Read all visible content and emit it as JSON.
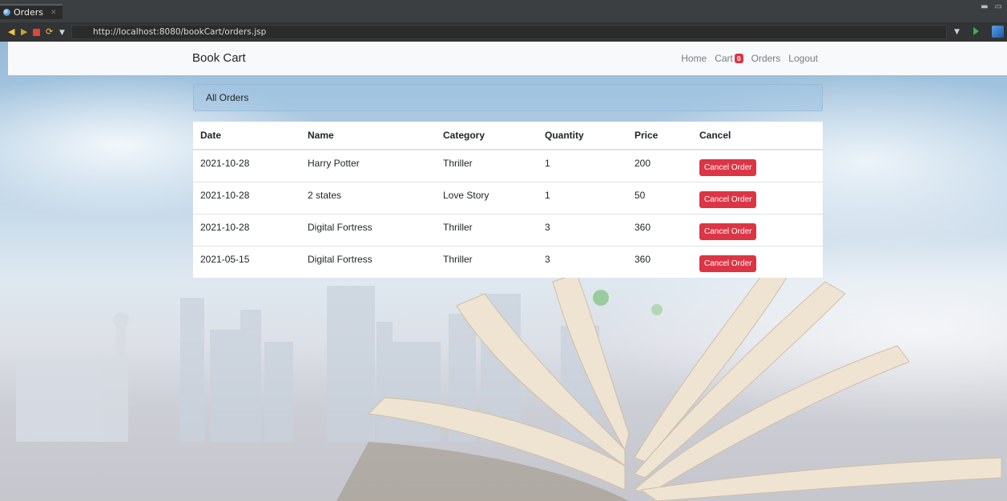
{
  "browser": {
    "tab_title": "Orders",
    "url": "http://localhost:8080/bookCart/orders.jsp"
  },
  "navbar": {
    "brand": "Book Cart",
    "links": {
      "home": "Home",
      "cart": "Cart",
      "cart_count": "0",
      "orders": "Orders",
      "logout": "Logout"
    }
  },
  "card": {
    "header": "All Orders"
  },
  "table": {
    "columns": [
      "Date",
      "Name",
      "Category",
      "Quantity",
      "Price",
      "Cancel"
    ],
    "rows": [
      {
        "date": "2021-10-28",
        "name": "Harry Potter",
        "category": "Thriller",
        "quantity": "1",
        "price": "200",
        "action": "Cancel Order"
      },
      {
        "date": "2021-10-28",
        "name": "2 states",
        "category": "Love Story",
        "quantity": "1",
        "price": "50",
        "action": "Cancel Order"
      },
      {
        "date": "2021-10-28",
        "name": "Digital Fortress",
        "category": "Thriller",
        "quantity": "3",
        "price": "360",
        "action": "Cancel Order"
      },
      {
        "date": "2021-05-15",
        "name": "Digital Fortress",
        "category": "Thriller",
        "quantity": "3",
        "price": "360",
        "action": "Cancel Order"
      }
    ]
  },
  "colors": {
    "danger": "#dc3545",
    "navbar_bg": "#f8f9fa",
    "chrome_bg": "#3c3f41"
  }
}
